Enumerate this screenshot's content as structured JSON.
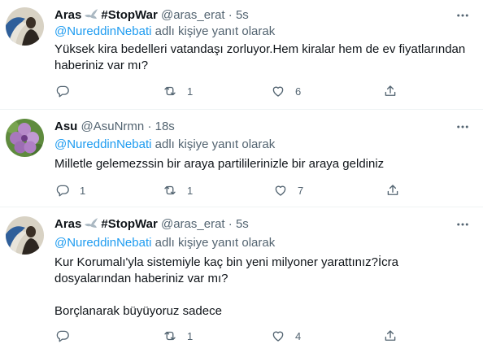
{
  "tweets": [
    {
      "name": "Aras",
      "badge_text": "#StopWar",
      "handle": "@aras_erat",
      "dot": "·",
      "time": "5s",
      "mention": "@NureddinNebati",
      "reply_suffix": "adlı kişiye yanıt olarak",
      "text": "Yüksek kira bedelleri vatandaşı zorluyor.Hem kiralar hem de ev fiyatlarından haberiniz var mı?",
      "replies": "",
      "retweets": "1",
      "likes": "6"
    },
    {
      "name": "Asu",
      "badge_text": "",
      "handle": "@AsuNrmn",
      "dot": "·",
      "time": "18s",
      "mention": "@NureddinNebati",
      "reply_suffix": "adlı kişiye yanıt olarak",
      "text": "Milletle gelemezssin bir araya partililerinizle bir araya geldiniz",
      "replies": "1",
      "retweets": "1",
      "likes": "7"
    },
    {
      "name": "Aras",
      "badge_text": "#StopWar",
      "handle": "@aras_erat",
      "dot": "·",
      "time": "5s",
      "mention": "@NureddinNebati",
      "reply_suffix": "adlı kişiye yanıt olarak",
      "text": "Kur Korumalı'yla sistemiyle kaç bin yeni milyoner yarattınız?İcra dosyalarından haberiniz var mı?\n\nBorçlanarak büyüyoruz sadece",
      "replies": "",
      "retweets": "1",
      "likes": "4"
    }
  ],
  "colors": {
    "accent": "#1d9bf0",
    "text": "#0f1419",
    "muted": "#536471",
    "divider": "#eff3f4"
  },
  "icons": [
    "more-icon",
    "reply-icon",
    "retweet-icon",
    "like-icon",
    "share-icon",
    "dove-icon"
  ]
}
